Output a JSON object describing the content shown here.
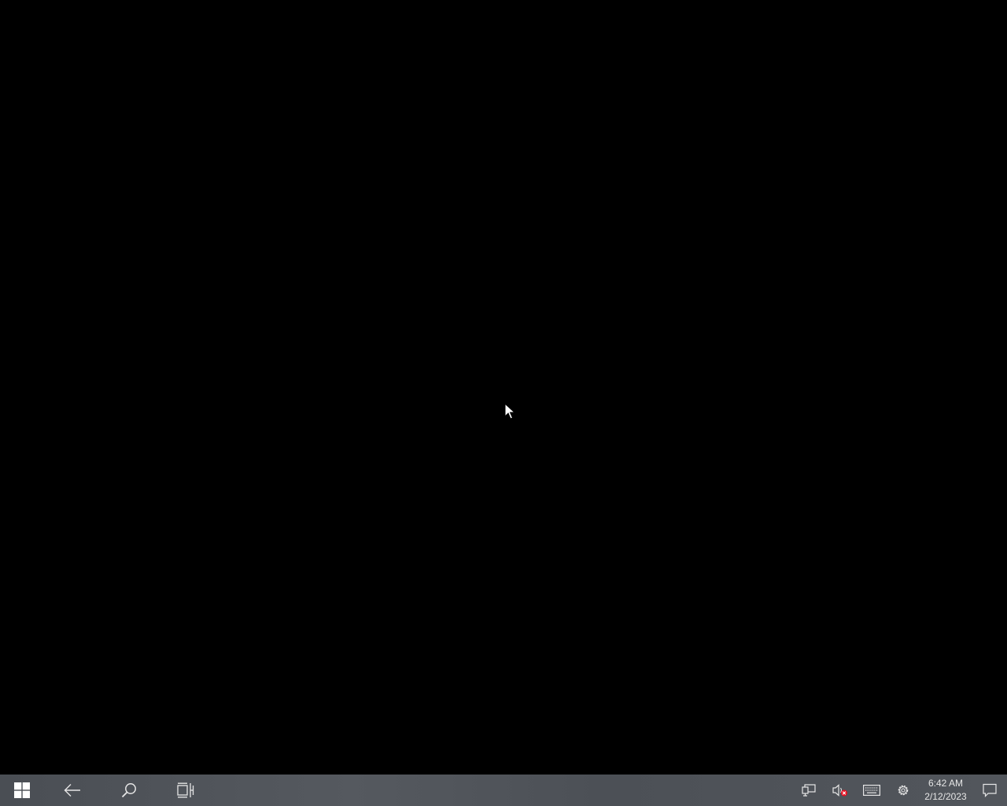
{
  "desktop": {
    "background_color": "#000000"
  },
  "taskbar": {
    "background_color": "#4f5359",
    "buttons": [
      {
        "name": "start",
        "icon": "windows-logo-icon"
      },
      {
        "name": "back",
        "icon": "back-arrow-icon"
      },
      {
        "name": "search",
        "icon": "search-icon"
      },
      {
        "name": "task-view",
        "icon": "task-view-icon"
      }
    ],
    "tray": {
      "icons": [
        {
          "name": "network",
          "icon": "network-icon"
        },
        {
          "name": "volume",
          "icon": "volume-muted-icon"
        },
        {
          "name": "keyboard",
          "icon": "touch-keyboard-icon"
        },
        {
          "name": "settings",
          "icon": "gear-icon"
        }
      ],
      "clock": {
        "time": "6:42 AM",
        "date": "2/12/2023"
      },
      "notification_icon": "action-center-icon"
    }
  },
  "colors": {
    "icon": "#e6e6e6",
    "muted_badge": "#e81123"
  }
}
